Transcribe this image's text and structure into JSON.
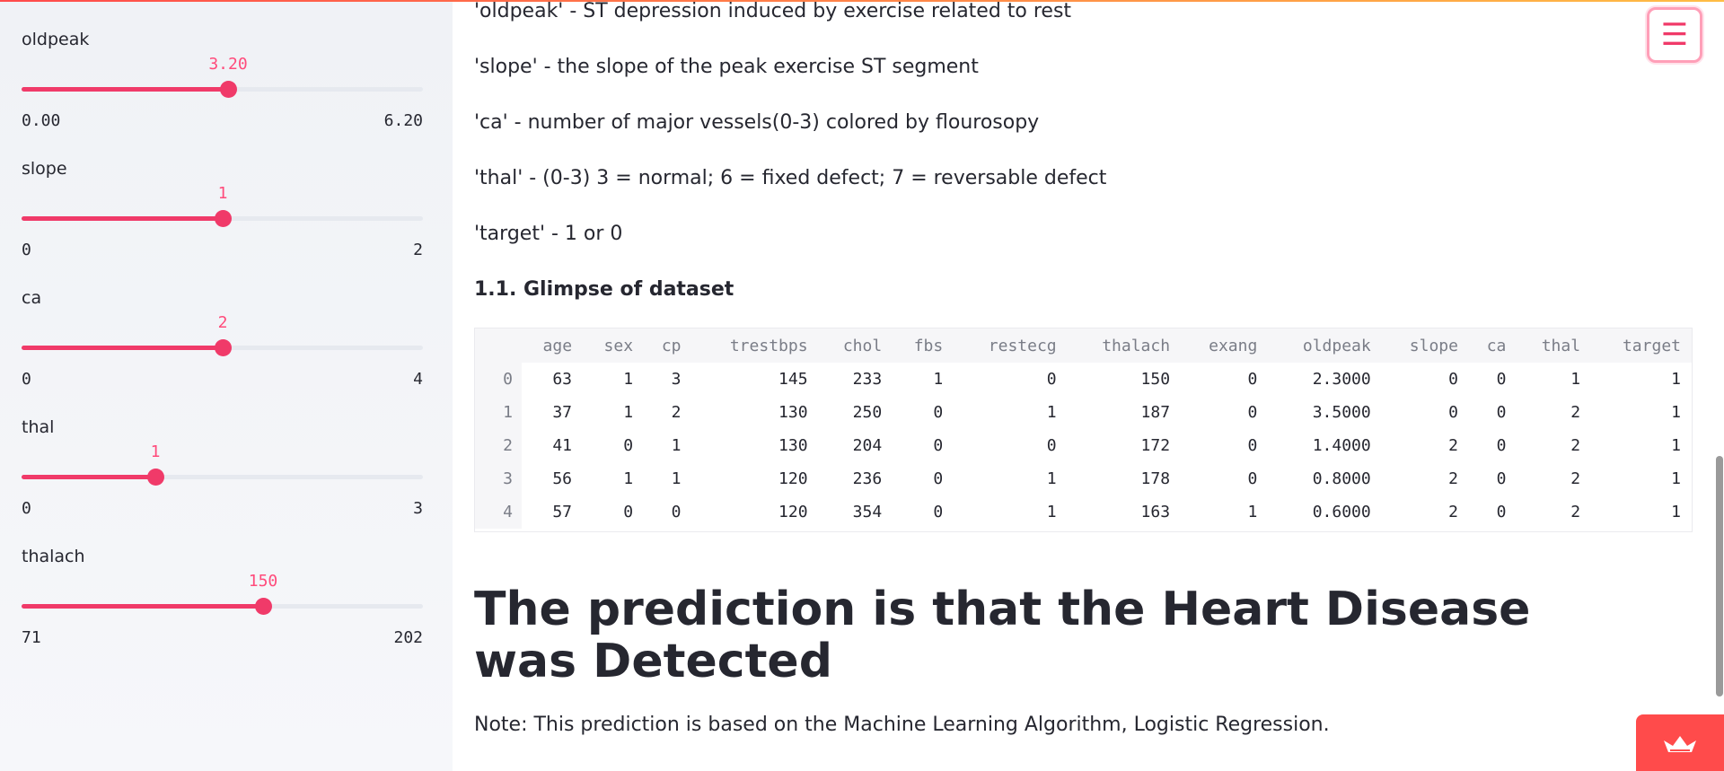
{
  "sidebar": {
    "sliders": [
      {
        "label": "oldpeak",
        "value": "3.20",
        "min": "0.00",
        "max": "6.20",
        "fraction": 0.516
      },
      {
        "label": "slope",
        "value": "1",
        "min": "0",
        "max": "2",
        "fraction": 0.5
      },
      {
        "label": "ca",
        "value": "2",
        "min": "0",
        "max": "4",
        "fraction": 0.5
      },
      {
        "label": "thal",
        "value": "1",
        "min": "0",
        "max": "3",
        "fraction": 0.333
      },
      {
        "label": "thalach",
        "value": "150",
        "min": "71",
        "max": "202",
        "fraction": 0.603
      }
    ]
  },
  "main": {
    "descriptions": [
      "'oldpeak' - ST depression induced by exercise related to rest",
      "'slope' - the slope of the peak exercise ST segment",
      "'ca' - number of major vessels(0-3) colored by flourosopy",
      "'thal' - (0-3) 3 = normal; 6 = fixed defect; 7 = reversable defect",
      "'target' - 1 or 0"
    ],
    "subheading": "1.1. Glimpse of dataset",
    "table": {
      "columns": [
        "age",
        "sex",
        "cp",
        "trestbps",
        "chol",
        "fbs",
        "restecg",
        "thalach",
        "exang",
        "oldpeak",
        "slope",
        "ca",
        "thal",
        "target"
      ],
      "rows": [
        {
          "index": "0",
          "cells": [
            "63",
            "1",
            "3",
            "145",
            "233",
            "1",
            "0",
            "150",
            "0",
            "2.3000",
            "0",
            "0",
            "1",
            "1"
          ]
        },
        {
          "index": "1",
          "cells": [
            "37",
            "1",
            "2",
            "130",
            "250",
            "0",
            "1",
            "187",
            "0",
            "3.5000",
            "0",
            "0",
            "2",
            "1"
          ]
        },
        {
          "index": "2",
          "cells": [
            "41",
            "0",
            "1",
            "130",
            "204",
            "0",
            "0",
            "172",
            "0",
            "1.4000",
            "2",
            "0",
            "2",
            "1"
          ]
        },
        {
          "index": "3",
          "cells": [
            "56",
            "1",
            "1",
            "120",
            "236",
            "0",
            "1",
            "178",
            "0",
            "0.8000",
            "2",
            "0",
            "2",
            "1"
          ]
        },
        {
          "index": "4",
          "cells": [
            "57",
            "0",
            "0",
            "120",
            "354",
            "0",
            "1",
            "163",
            "1",
            "0.6000",
            "2",
            "0",
            "2",
            "1"
          ]
        }
      ]
    },
    "prediction_heading": "The prediction is that the Heart Disease was Detected",
    "note": "Note: This prediction is based on the Machine Learning Algorithm, Logistic Regression."
  },
  "menu": {
    "icon": "hamburger-menu-icon",
    "glyph": "☰"
  },
  "colors": {
    "accent": "#f03a69",
    "badge": "#ff4b4b"
  }
}
